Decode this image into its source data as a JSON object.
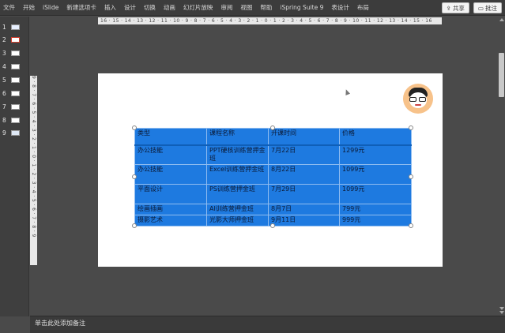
{
  "menu": {
    "items": [
      "文件",
      "开始",
      "iSlide",
      "新建选项卡",
      "插入",
      "设计",
      "切换",
      "动画",
      "幻灯片放映",
      "审阅",
      "视图",
      "帮助",
      "iSpring Suite 9",
      "表设计",
      "布局"
    ],
    "share_label": "共享",
    "comment_label": "批注"
  },
  "thumbnails": {
    "numbers": [
      "1",
      "2",
      "3",
      "4",
      "5",
      "6",
      "7",
      "8",
      "9"
    ],
    "selected": "2"
  },
  "rulers": {
    "horizontal": "16 · 15 · 14 · 13 · 12 · 11 · 10 · 9 · 8 · 7 · 6 · 5 · 4 · 3 · 2 · 1 · 0 · 1 · 2 · 3 · 4 · 5 · 6 · 7 · 8 · 9 · 10 · 11 · 12 · 13 · 14 · 15 · 16",
    "vertical": "9 · 8 · 7 · 6 · 5 · 4 · 3 · 2 · 1 · 0 · 1 · 2 · 3 · 4 · 5 · 6 · 7 · 8 · 9"
  },
  "table": {
    "headers": [
      "类型",
      "课程名称",
      "开课时间",
      "价格"
    ],
    "rows": [
      [
        "办公技能",
        "PPT硬核训练营押金班",
        "7月22日",
        "1299元"
      ],
      [
        "办公技能",
        "Excel训练营押金班",
        "8月22日",
        "1099元"
      ],
      [
        "平面设计",
        "PS训练营押金班",
        "7月29日",
        "1099元"
      ],
      [
        "绘画插画",
        "AI训练营押金班",
        "8月7日",
        "799元"
      ],
      [
        "摄影艺术",
        "光影大师押金班",
        "9月11日",
        "999元"
      ]
    ]
  },
  "notes": {
    "placeholder": "单击此处添加备注"
  },
  "colors": {
    "table_fill": "#1e7ae0",
    "selected_thumb_border": "#d04030"
  }
}
